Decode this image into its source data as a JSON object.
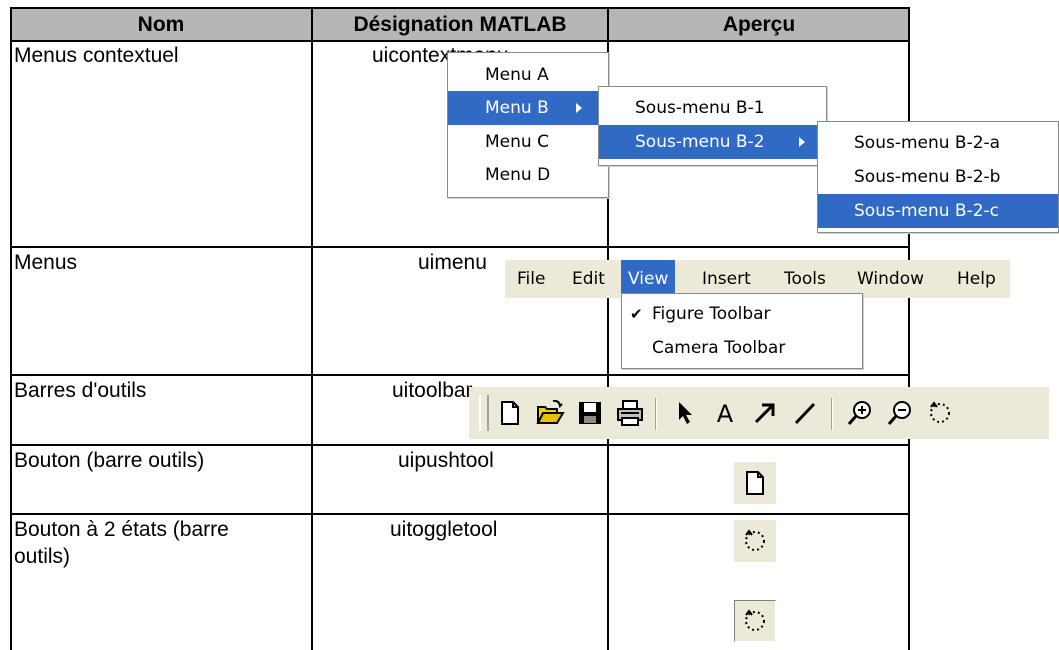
{
  "table": {
    "headers": [
      "Nom",
      "Désignation MATLAB",
      "Aperçu"
    ],
    "rows": [
      {
        "nom": "Menus contextuel",
        "designation": "uicontextmenu"
      },
      {
        "nom": "Menus",
        "designation": "uimenu"
      },
      {
        "nom": "Barres d'outils",
        "designation": "uitoolbar"
      },
      {
        "nom": "Bouton (barre outils)",
        "designation": "uipushtool"
      },
      {
        "nom_line1": "Bouton à 2 états (barre",
        "nom_line2": "outils)",
        "designation": "uitoggletool"
      }
    ]
  },
  "context_menu": {
    "items": [
      "Menu A",
      "Menu B",
      "Menu C",
      "Menu D"
    ],
    "selected": "Menu B",
    "submenu_b": {
      "items": [
        "Sous-menu B-1",
        "Sous-menu B-2"
      ],
      "selected": "Sous-menu B-2"
    },
    "submenu_b2": {
      "items": [
        "Sous-menu B-2-a",
        "Sous-menu B-2-b",
        "Sous-menu B-2-c"
      ],
      "selected": "Sous-menu B-2-c"
    }
  },
  "menubar": {
    "items": [
      "File",
      "Edit",
      "View",
      "Insert",
      "Tools",
      "Window",
      "Help"
    ],
    "selected": "View",
    "view_menu": {
      "items": [
        {
          "label": "Figure Toolbar",
          "checked": true
        },
        {
          "label": "Camera Toolbar",
          "checked": false
        }
      ]
    }
  },
  "toolbar": {
    "icons": [
      "new-file-icon",
      "open-folder-icon",
      "save-icon",
      "print-icon",
      "select-arrow-icon",
      "text-icon",
      "arrow-icon",
      "line-icon",
      "zoom-in-icon",
      "zoom-out-icon",
      "rotate-icon"
    ]
  },
  "colors": {
    "header_bg": "#b6b6b6",
    "menu_highlight": "#316ac5",
    "toolbar_bg": "#ece9d8"
  }
}
